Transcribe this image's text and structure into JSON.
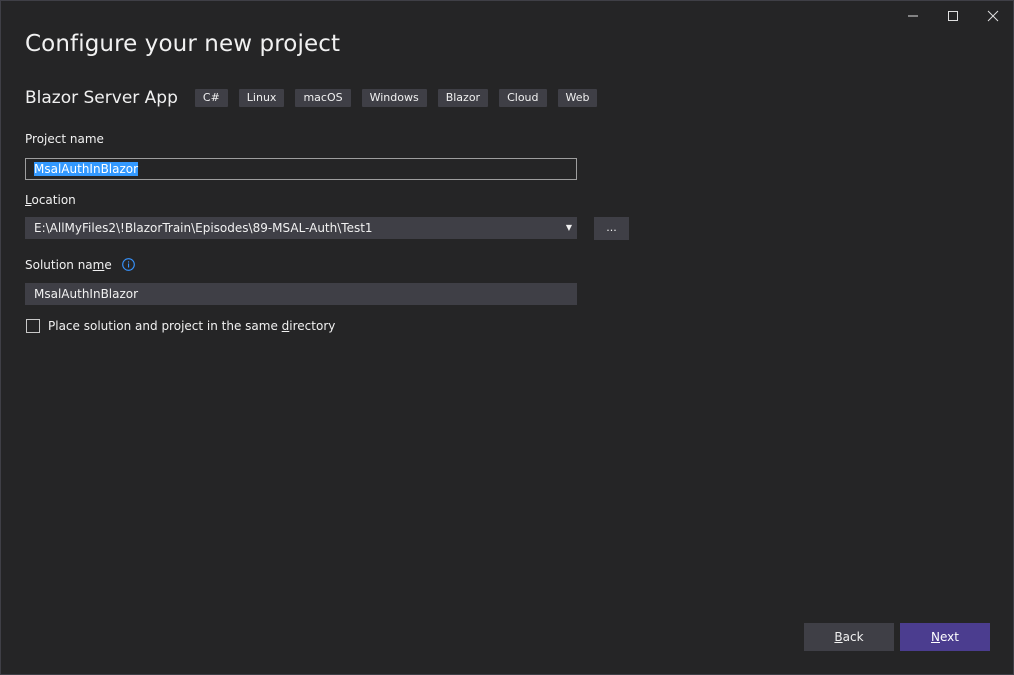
{
  "window": {
    "title": "Configure your new project",
    "controls": [
      "minimize-icon",
      "maximize-icon",
      "close-icon"
    ]
  },
  "template": {
    "name": "Blazor Server App",
    "tags": [
      "C#",
      "Linux",
      "macOS",
      "Windows",
      "Blazor",
      "Cloud",
      "Web"
    ]
  },
  "project_name": {
    "label": "Project name",
    "value": "MsalAuthInBlazor"
  },
  "location": {
    "label_prefix": "",
    "label_underlined": "L",
    "label_suffix": "ocation",
    "value": "E:\\AllMyFiles2\\!BlazorTrain\\Episodes\\89-MSAL-Auth\\Test1",
    "browse_label": "..."
  },
  "solution_name": {
    "label_prefix": "Solution na",
    "label_underlined": "m",
    "label_suffix": "e",
    "value": "MsalAuthInBlazor",
    "info_icon": "info-icon"
  },
  "same_directory": {
    "label_prefix": "Place solution and project in the same ",
    "label_underlined": "d",
    "label_suffix": "irectory",
    "checked": false
  },
  "footer": {
    "back_underlined": "B",
    "back_rest": "ack",
    "next_underlined": "N",
    "next_rest": "ext"
  },
  "colors": {
    "background": "#252526",
    "input_bg": "#3f3f46",
    "selection": "#3399ff",
    "primary_button": "#4b3d8f",
    "info_icon": "#3794ff"
  }
}
